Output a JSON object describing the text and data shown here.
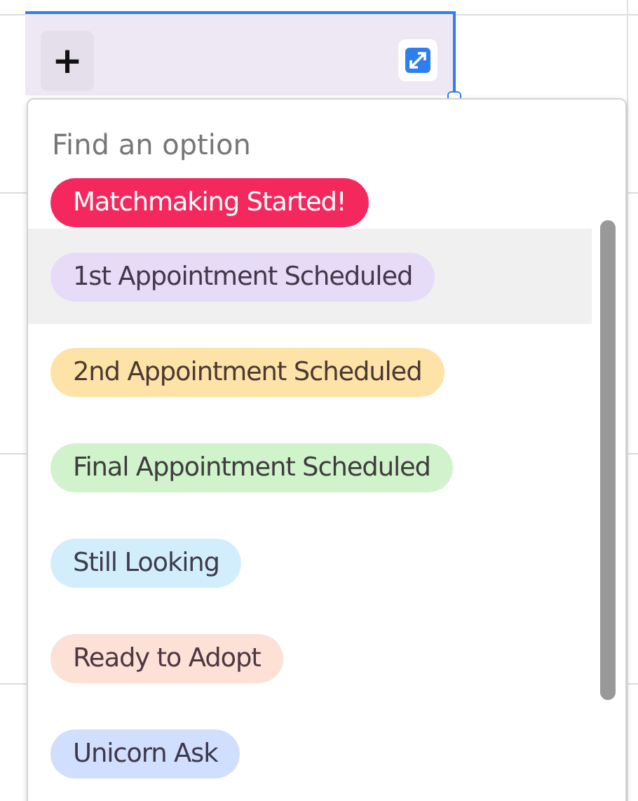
{
  "cell": {
    "add_label": "+"
  },
  "dropdown": {
    "search": {
      "placeholder": "Find an option"
    },
    "options": [
      {
        "label": "Matchmaking Started!",
        "color": "#f5285e",
        "selected": false
      },
      {
        "label": "1st Appointment Scheduled",
        "color": "#e6dcf8",
        "selected": true
      },
      {
        "label": "2nd Appointment Scheduled",
        "color": "#fee3a8",
        "selected": false
      },
      {
        "label": "Final Appointment Scheduled",
        "color": "#d0f3cb",
        "selected": false
      },
      {
        "label": "Still Looking",
        "color": "#d2eefc",
        "selected": false
      },
      {
        "label": "Ready to Adopt",
        "color": "#fde0d6",
        "selected": false
      },
      {
        "label": "Unicorn Ask",
        "color": "#d0dffd",
        "selected": false
      }
    ]
  }
}
